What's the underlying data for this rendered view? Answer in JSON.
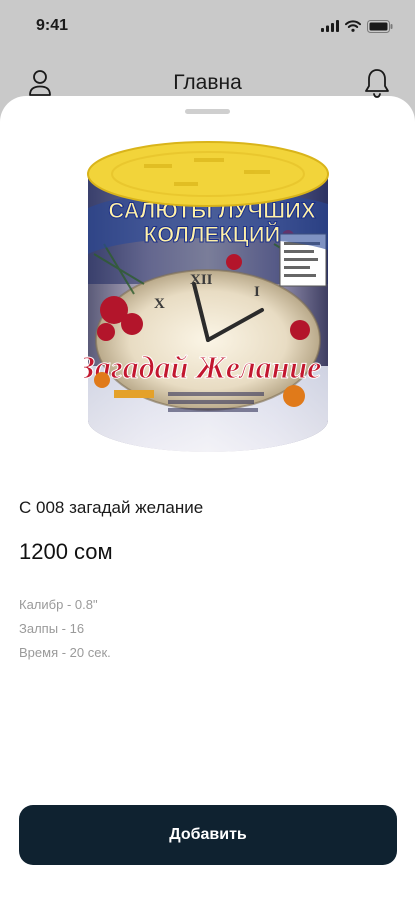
{
  "status_bar": {
    "time": "9:41",
    "icons": [
      "signal-icon",
      "wifi-icon",
      "battery-icon"
    ]
  },
  "header": {
    "title": "Главна",
    "left_icon": "user-icon",
    "right_icon": "bell-icon"
  },
  "product": {
    "image_label_line1": "САЛЮТЫ ЛУЧШИХ",
    "image_label_line2": "КОЛЛЕКЦИЙ",
    "image_script_text": "Загадай Желание",
    "name": "С 008 загадай желание",
    "price": "1200 сом",
    "specs": {
      "caliber": "Калибр - 0.8\"",
      "shots": "Залпы - 16",
      "time": "Время - 20 сек."
    }
  },
  "actions": {
    "add_label": "Добавить"
  },
  "colors": {
    "background": "#c9c9c9",
    "sheet": "#ffffff",
    "button": "#0f2230",
    "button_text": "#ffffff",
    "spec_text": "#9a9a9a"
  }
}
